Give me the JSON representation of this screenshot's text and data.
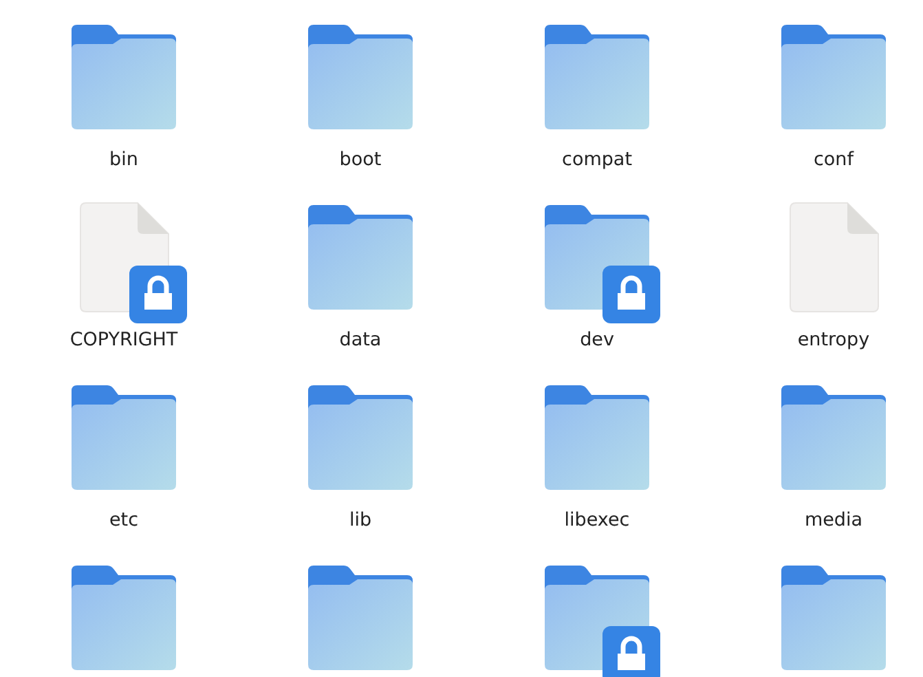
{
  "items": [
    {
      "kind": "folder",
      "name": "bin",
      "locked": false
    },
    {
      "kind": "folder",
      "name": "boot",
      "locked": false
    },
    {
      "kind": "folder",
      "name": "compat",
      "locked": false
    },
    {
      "kind": "folder",
      "name": "conf",
      "locked": false
    },
    {
      "kind": "file",
      "name": "COPYRIGHT",
      "locked": true
    },
    {
      "kind": "folder",
      "name": "data",
      "locked": false
    },
    {
      "kind": "folder",
      "name": "dev",
      "locked": true
    },
    {
      "kind": "file",
      "name": "entropy",
      "locked": false
    },
    {
      "kind": "folder",
      "name": "etc",
      "locked": false
    },
    {
      "kind": "folder",
      "name": "lib",
      "locked": false
    },
    {
      "kind": "folder",
      "name": "libexec",
      "locked": false
    },
    {
      "kind": "folder",
      "name": "media",
      "locked": false
    },
    {
      "kind": "folder",
      "locked": false
    },
    {
      "kind": "folder",
      "locked": false
    },
    {
      "kind": "folder",
      "locked": true
    },
    {
      "kind": "folder",
      "locked": false
    }
  ]
}
